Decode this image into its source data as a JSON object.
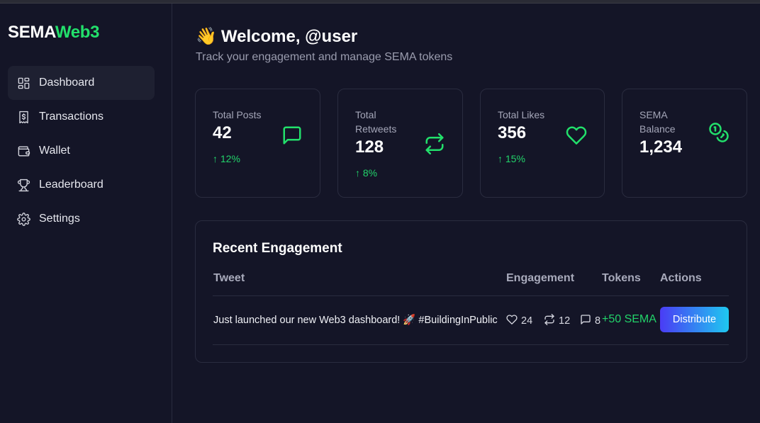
{
  "brand": {
    "part1": "SEMA",
    "part2": "Web3",
    "accent_color": "#22e06b"
  },
  "sidebar": {
    "items": [
      {
        "label": "Dashboard",
        "icon": "dashboard-icon",
        "active": true
      },
      {
        "label": "Transactions",
        "icon": "receipt-dollar-icon"
      },
      {
        "label": "Wallet",
        "icon": "wallet-icon"
      },
      {
        "label": "Leaderboard",
        "icon": "trophy-icon"
      },
      {
        "label": "Settings",
        "icon": "gear-icon"
      }
    ]
  },
  "header": {
    "emoji": "👋",
    "title": "Welcome, @user",
    "subtitle": "Track your engagement and manage SEMA tokens"
  },
  "stats": [
    {
      "label": "Total Posts",
      "value": "42",
      "delta": "↑ 12%",
      "icon": "message-square-icon"
    },
    {
      "label": "Total Retweets",
      "value": "128",
      "delta": "↑ 8%",
      "icon": "repeat-icon"
    },
    {
      "label": "Total Likes",
      "value": "356",
      "delta": "↑ 15%",
      "icon": "heart-icon"
    },
    {
      "label": "SEMA Balance",
      "value": "1,234",
      "delta": "",
      "icon": "coins-icon"
    }
  ],
  "recent": {
    "title": "Recent Engagement",
    "columns": [
      "Tweet",
      "Engagement",
      "Tokens",
      "Actions"
    ],
    "rows": [
      {
        "tweet": "Just launched our new Web3 dashboard! 🚀 #BuildingInPublic",
        "likes": "24",
        "retweets": "12",
        "comments": "8",
        "tokens": "+50 SEMA",
        "action": "Distribute"
      }
    ]
  }
}
